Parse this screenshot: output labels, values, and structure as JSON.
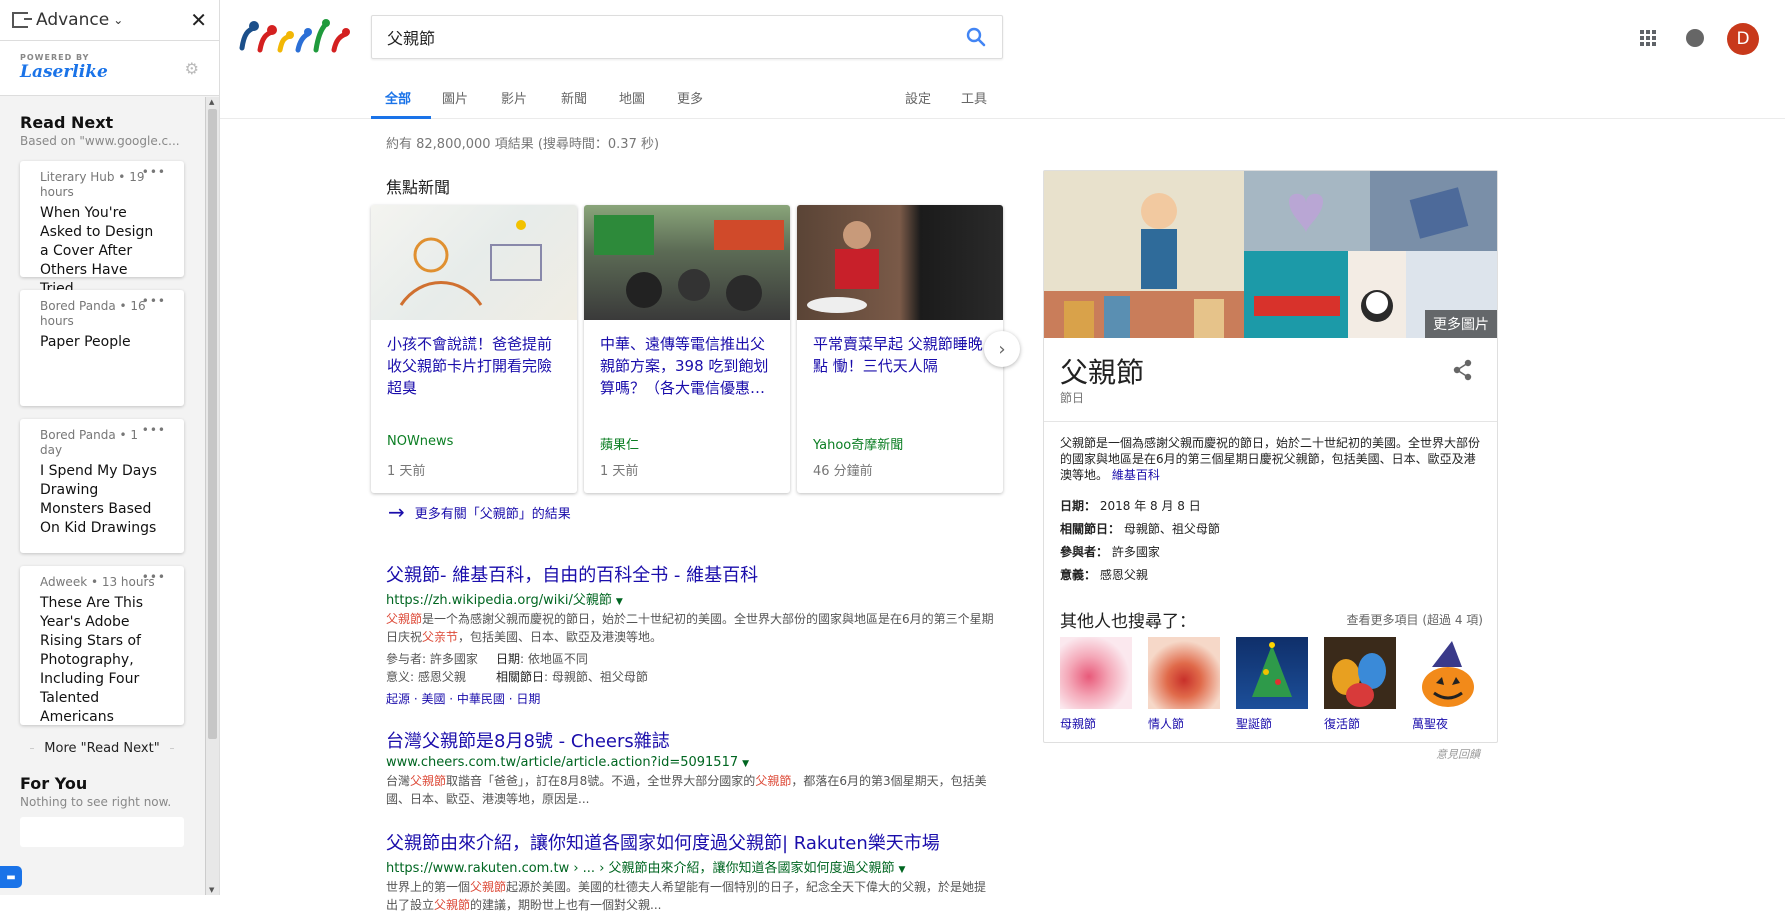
{
  "sidebar": {
    "title": "Advance",
    "powered_by": "POWERED BY",
    "brand": "Laserlike",
    "read_next_heading": "Read Next",
    "read_next_sub": "Based on \"www.google.c...",
    "cards": [
      {
        "meta": "Literary Hub • 19 hours",
        "title": "When You're Asked to Design a Cover After Others Have Tried..."
      },
      {
        "meta": "Bored Panda • 16 hours",
        "title": "Paper People"
      },
      {
        "meta": "Bored Panda • 1 day",
        "title": "I Spend My Days Drawing Monsters Based On Kid Drawings"
      },
      {
        "meta": "Adweek • 13 hours",
        "title": "These Are This Year's Adobe Rising Stars of Photography, Including Four Talented Americans"
      }
    ],
    "more_read_next": "More \"Read Next\"",
    "for_you_heading": "For You",
    "for_you_sub": "Nothing to see right now."
  },
  "search": {
    "query": "父親節"
  },
  "avatar_letter": "D",
  "tabs": [
    "全部",
    "圖片",
    "影片",
    "新聞",
    "地圖",
    "更多",
    "設定",
    "工具"
  ],
  "stats": "約有 82,800,000 項結果 (搜尋時間：0.37 秒)",
  "top_stories": {
    "heading": "焦點新聞",
    "items": [
      {
        "title": "小孩不會說謊！爸爸提前收父親節卡片打開看完險超臭",
        "source": "NOWnews",
        "time": "1 天前"
      },
      {
        "title": "中華、遠傳等電信推出父親節方案，398 吃到飽划算嗎？（各大電信優惠…",
        "source": "蘋果仁",
        "time": "1 天前"
      },
      {
        "title": "平常賣菜早起 父親節睡晚點 慟！三代天人隔",
        "source": "Yahoo奇摩新聞",
        "time": "46 分鐘前"
      }
    ],
    "more": "更多有關「父親節」的結果"
  },
  "results": [
    {
      "title": "父親節- 維基百科，自由的百科全书 - 維基百科",
      "url": "https://zh.wikipedia.org/wiki/父親節",
      "desc_prefix": "",
      "desc_em1": "父親節",
      "desc_mid": "是一个為感謝父親而慶祝的節日，始於二十世紀初的美國。全世界大部份的國家與地區是在6月的第三个星期日庆祝",
      "desc_em2": "父亲节",
      "desc_end": "，包括美國、日本、歐亞及港澳等地。",
      "facts": [
        {
          "k": "參与者",
          "v": "許多國家"
        },
        {
          "k": "日期",
          "v": "依地區不同"
        },
        {
          "k": "意义",
          "v": "感恩父親"
        },
        {
          "k": "相關節日",
          "v": "母親節、祖父母節"
        }
      ],
      "sublinks": "起源 · 美國 · 中華民國 · 日期"
    },
    {
      "title": "台灣父親節是8月8號 - Cheers雜誌",
      "url": "www.cheers.com.tw/article/article.action?id=5091517",
      "desc_prefix": "台灣",
      "desc_em1": "父親節",
      "desc_mid": "取諧音「爸爸」，訂在8月8號。不過，全世界大部分國家的",
      "desc_em2": "父親節",
      "desc_end": "，都落在6月的第3個星期天，包括美國、日本、歐亞、港澳等地，原因是..."
    },
    {
      "title": "父親節由來介紹，讓你知道各國家如何度過父親節| Rakuten樂天市場",
      "url": "https://www.rakuten.com.tw › ... › 父親節由來介紹，讓你知道各國家如何度過父親節",
      "desc_prefix": "世界上的第一個",
      "desc_em1": "父親節",
      "desc_mid": "起源於美國。美國的杜德夫人希望能有一個特別的日子，紀念全天下偉大的父親，於是她提出了設立",
      "desc_em2": "父親節",
      "desc_end": "的建議，期盼世上也有一個對父親..."
    }
  ],
  "knowledge_panel": {
    "more_images": "更多圖片",
    "title": "父親節",
    "type": "節日",
    "desc": "父親節是一個為感謝父親而慶祝的節日，始於二十世紀初的美國。全世界大部份的國家與地區是在6月的第三個星期日慶祝父親節，包括美國、日本、歐亞及港澳等地。",
    "desc_link": "維基百科",
    "facts": [
      {
        "k": "日期：",
        "v": "2018 年 8 月 8 日"
      },
      {
        "k": "相關節日：",
        "v": "母親節、祖父母節"
      },
      {
        "k": "參與者：",
        "v": "許多國家"
      },
      {
        "k": "意義：",
        "v": "感恩父親"
      }
    ],
    "also_heading": "其他人也搜尋了：",
    "also_more": "查看更多項目 (超過 4 項)",
    "also": [
      "母親節",
      "情人節",
      "聖誕節",
      "復活節",
      "萬聖夜"
    ],
    "feedback": "意見回饋"
  },
  "colors": {
    "link": "#1a0dab",
    "url": "#006621",
    "accent": "#1a73e8",
    "avatar": "#c8391b",
    "em": "#dd4b39"
  }
}
